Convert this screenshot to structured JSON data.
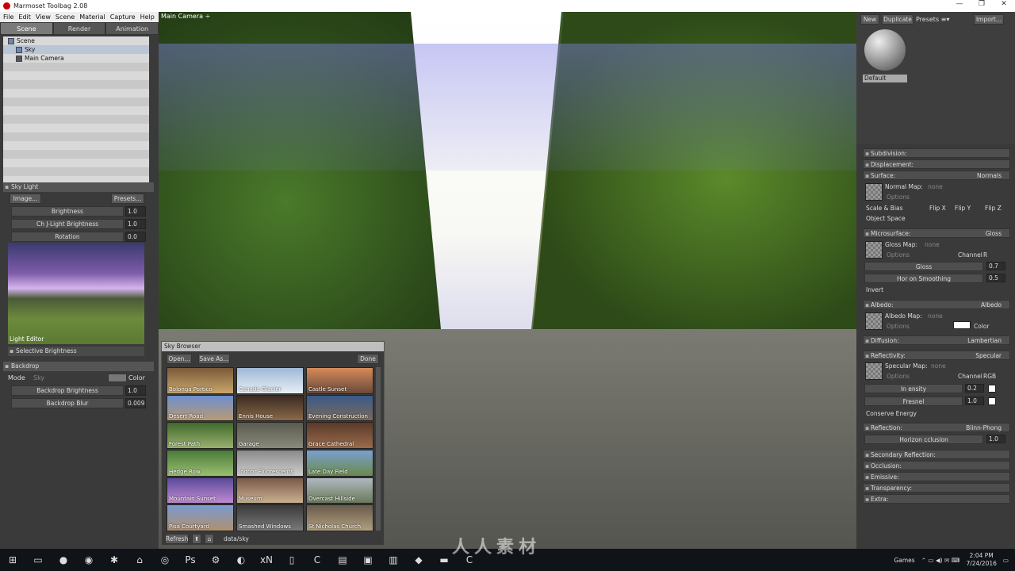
{
  "window": {
    "title": "Marmoset Toolbag 2.08",
    "controls": [
      "—",
      "❐",
      "✕"
    ]
  },
  "menu": [
    "File",
    "Edit",
    "View",
    "Scene",
    "Material",
    "Capture",
    "Help"
  ],
  "left_tabs": [
    "Scene",
    "Render",
    "Animation"
  ],
  "scene_tree": [
    "Scene",
    "Sky",
    "Main Camera"
  ],
  "sky_light": {
    "title": "Sky Light",
    "image_btn": "Image...",
    "presets_btn": "Presets...",
    "brightness_label": "Brightness",
    "brightness_val": "1.0",
    "child_label": "Ch    J-Light Brightness",
    "child_val": "1.0",
    "rotation_label": "Rotation",
    "rotation_val": "0.0",
    "light_editor": "Light Editor",
    "selective": "Selective Brightness"
  },
  "backdrop": {
    "title": "Backdrop",
    "mode_label": "Mode",
    "mode_val": "Sky",
    "color_label": "Color",
    "brightness_label": "Backdrop Brightness",
    "brightness_val": "1.0",
    "blur_label": "Backdrop Blur",
    "blur_val": "0.009"
  },
  "viewport": {
    "camera_label": "Main Camera ÷"
  },
  "sky_browser": {
    "title": "Sky Browser",
    "open": "Open...",
    "save": "Save As...",
    "done": "Done",
    "refresh": "Refresh",
    "path": "data/sky",
    "skies": [
      {
        "name": "Bolonga Portico",
        "c1": "#7a5a3a",
        "c2": "#c9a66b"
      },
      {
        "name": "Canada Glacier",
        "c1": "#9fb8d6",
        "c2": "#e8eef5"
      },
      {
        "name": "Castle Sunset",
        "c1": "#d58a5a",
        "c2": "#6a4a3a"
      },
      {
        "name": "Desert Road",
        "c1": "#6d8fd0",
        "c2": "#b89a72"
      },
      {
        "name": "Ennis House",
        "c1": "#3a2a20",
        "c2": "#8a6a4a"
      },
      {
        "name": "Evening Construction",
        "c1": "#3a5a8a",
        "c2": "#7a6a5a"
      },
      {
        "name": "Forest Path",
        "c1": "#3f6a2a",
        "c2": "#9ab070"
      },
      {
        "name": "Garage",
        "c1": "#5a5a50",
        "c2": "#8a8a7a"
      },
      {
        "name": "Grace Cathedral",
        "c1": "#5a3a2a",
        "c2": "#9a6a4a"
      },
      {
        "name": "Hedge Row",
        "c1": "#4a7a3a",
        "c2": "#9ac070"
      },
      {
        "name": "Indoor Fluorescents",
        "c1": "#8a8a8a",
        "c2": "#cfcfcf"
      },
      {
        "name": "Late Day Field",
        "c1": "#7aa0d0",
        "c2": "#6a8a4a"
      },
      {
        "name": "Mountain Sunset",
        "c1": "#5a4a9a",
        "c2": "#c08ad0"
      },
      {
        "name": "Museum",
        "c1": "#7a5a4a",
        "c2": "#c9b090"
      },
      {
        "name": "Overcast Hillside",
        "c1": "#b0b8c0",
        "c2": "#6a7a5a"
      },
      {
        "name": "Pisa Courtyard",
        "c1": "#7a9ad0",
        "c2": "#b09070"
      },
      {
        "name": "Smashed Windows",
        "c1": "#3a3a3a",
        "c2": "#7a7a7a"
      },
      {
        "name": "St Nicholas Church",
        "c1": "#6a5a4a",
        "c2": "#b0a080"
      }
    ]
  },
  "material": {
    "new": "New",
    "duplicate": "Duplicate",
    "presets": "Presets ≡▾",
    "import": "Import...",
    "name": "Default",
    "sections": {
      "subdivision": "Subdivision:",
      "displacement": "Displacement:",
      "surface": "Surface:",
      "surface_val": "Normals",
      "normal_map": "Normal Map:",
      "none": "none",
      "options": "Options",
      "scale_bias": "Scale & Bias",
      "flip_x": "Flip X",
      "flip_y": "Flip Y",
      "flip_z": "Flip Z",
      "object_space": "Object Space",
      "microsurface": "Microsurface:",
      "microsurface_val": "Gloss",
      "gloss_map": "Gloss Map:",
      "channel": "Channel",
      "channel_r": "R",
      "gloss": "Gloss",
      "gloss_val": "0.7",
      "horizon_smoothing": "Hor   on Smoothing",
      "horizon_smoothing_val": "0.5",
      "invert": "Invert",
      "albedo": "Albedo:",
      "albedo_val": "Albedo",
      "albedo_map": "Albedo Map:",
      "color": "Color",
      "diffusion": "Diffusion:",
      "diffusion_val": "Lambertian",
      "reflectivity": "Reflectivity:",
      "reflectivity_val": "Specular",
      "specular_map": "Specular Map:",
      "channel_rgb": "RGB",
      "intensity": "In   ensity",
      "intensity_val": "0.2",
      "fresnel": "Fresnel",
      "fresnel_val": "1.0",
      "conserve": "Conserve Energy",
      "reflection": "Reflection:",
      "reflection_val": "Blinn-Phong",
      "horizon_occlusion": "Horizon   cclusion",
      "horizon_occlusion_val": "1.0",
      "secondary": "Secondary Reflection:",
      "occlusion": "Occlusion:",
      "emissive": "Emissive:",
      "transparency": "Transparency:",
      "extra": "Extra:"
    }
  },
  "taskbar": {
    "apps": [
      "⊞",
      "▭",
      "●",
      "◉",
      "✱",
      "⌂",
      "◎",
      "Ps",
      "⚙",
      "◐",
      "xN",
      "▯",
      "C",
      "▤",
      "▣",
      "▥",
      "◆",
      "▬",
      "C"
    ],
    "games": "Games",
    "time": "2:04 PM",
    "date": "7/24/2016"
  },
  "watermark": "人人素材"
}
